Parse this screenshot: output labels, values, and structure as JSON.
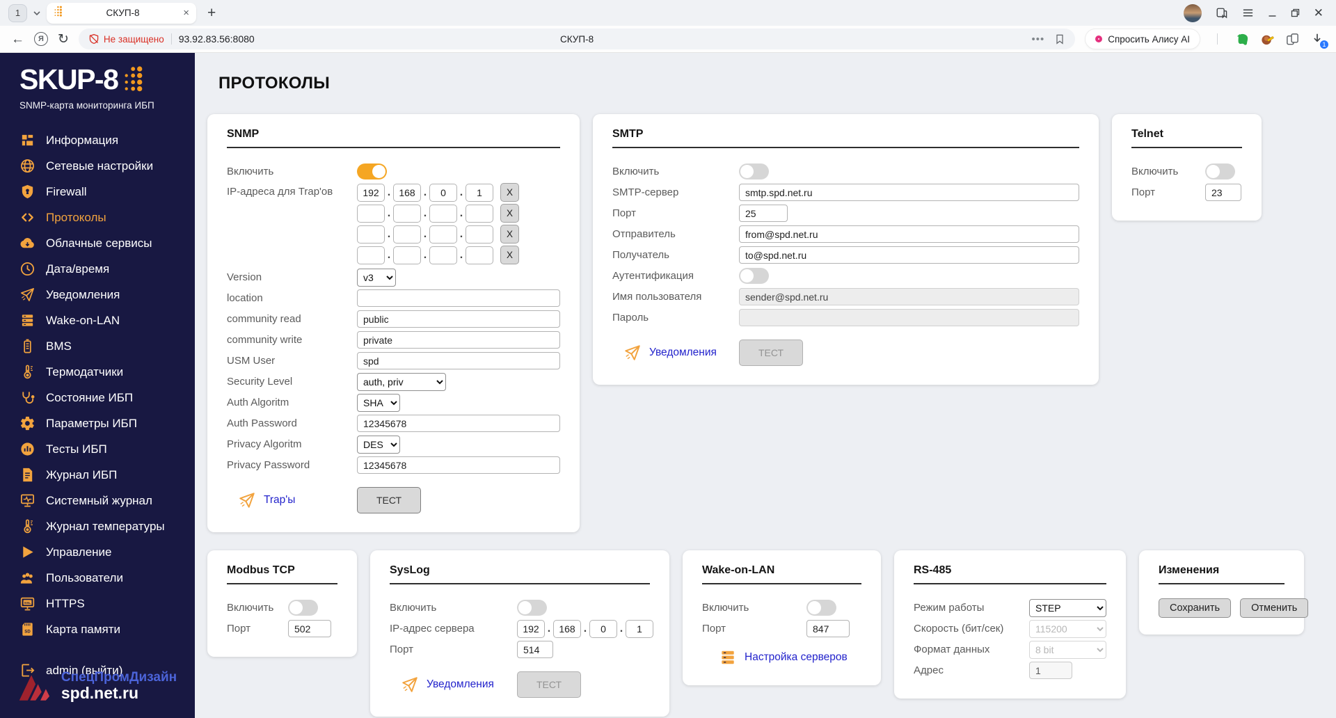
{
  "colors": {
    "sidebar_bg": "#181842",
    "accent_orange": "#f2a33e",
    "link_blue": "#2323cc",
    "warning_red": "#d93025",
    "toggle_on": "#f5a623"
  },
  "browser": {
    "tab_group_count": "1",
    "tab_title": "СКУП-8",
    "new_tab_label": "+",
    "security_text": "Не защищено",
    "url": "93.92.83.56:8080",
    "page_title": "СКУП-8",
    "alice_label": "Спросить Алису AI",
    "download_badge": "1"
  },
  "sidebar": {
    "logo_text": "SKUP-8",
    "subtitle": "SNMP-карта мониторинга ИБП",
    "items": [
      {
        "id": "info",
        "icon": "grid",
        "label": "Информация"
      },
      {
        "id": "network",
        "icon": "globe",
        "label": "Сетевые настройки"
      },
      {
        "id": "firewall",
        "icon": "shield",
        "label": "Firewall"
      },
      {
        "id": "protocols",
        "icon": "code",
        "label": "Протоколы",
        "active": true
      },
      {
        "id": "cloud",
        "icon": "cloud",
        "label": "Облачные сервисы"
      },
      {
        "id": "datetime",
        "icon": "clock",
        "label": "Дата/время"
      },
      {
        "id": "notifications",
        "icon": "send",
        "label": "Уведомления"
      },
      {
        "id": "wake-on-lan",
        "icon": "server",
        "label": "Wake-on-LAN"
      },
      {
        "id": "bms",
        "icon": "battery",
        "label": "BMS"
      },
      {
        "id": "thermosensors",
        "icon": "thermometer",
        "label": "Термодатчики"
      },
      {
        "id": "ups-status",
        "icon": "stethoscope",
        "label": "Состояние ИБП"
      },
      {
        "id": "ups-params",
        "icon": "gear",
        "label": "Параметры ИБП"
      },
      {
        "id": "ups-tests",
        "icon": "chart",
        "label": "Тесты ИБП"
      },
      {
        "id": "ups-log",
        "icon": "document",
        "label": "Журнал ИБП"
      },
      {
        "id": "system-log",
        "icon": "monitor",
        "label": "Системный журнал"
      },
      {
        "id": "temp-log",
        "icon": "thermometer",
        "label": "Журнал температуры"
      },
      {
        "id": "control",
        "icon": "play",
        "label": "Управление"
      },
      {
        "id": "users",
        "icon": "users",
        "label": "Пользователи"
      },
      {
        "id": "https",
        "icon": "ssl",
        "label": "HTTPS"
      },
      {
        "id": "memory-card",
        "icon": "sdcard",
        "label": "Карта памяти"
      },
      {
        "id": "logout",
        "icon": "logout",
        "label": "admin (выйти)",
        "gap_before": true
      }
    ],
    "footer": {
      "brand": "СпецПромДизайн",
      "site": "spd.net.ru"
    }
  },
  "page": {
    "title": "ПРОТОКОЛЫ"
  },
  "panels": {
    "snmp": {
      "title": "SNMP",
      "enable_label": "Включить",
      "enabled": "on",
      "trap_label": "IP-адреса для Trap'ов",
      "trap_ips": [
        [
          "192",
          "168",
          "0",
          "1"
        ],
        [
          "",
          "",
          "",
          ""
        ],
        [
          "",
          "",
          "",
          ""
        ],
        [
          "",
          "",
          "",
          ""
        ]
      ],
      "remove_label": "X",
      "version_label": "Version",
      "version_value": "v3",
      "location_label": "location",
      "location_value": "",
      "community_read_label": "community read",
      "community_read_value": "public",
      "community_write_label": "community write",
      "community_write_value": "private",
      "usm_user_label": "USM User",
      "usm_user_value": "spd",
      "security_level_label": "Security Level",
      "security_level_value": "auth, priv",
      "auth_algorithm_label": "Auth Algoritm",
      "auth_algorithm_value": "SHA",
      "auth_password_label": "Auth Password",
      "auth_password_value": "12345678",
      "privacy_algorithm_label": "Privacy Algoritm",
      "privacy_algorithm_value": "DES",
      "privacy_password_label": "Privacy Password",
      "privacy_password_value": "12345678",
      "traps_link": "Trap'ы",
      "test_button": "ТЕСТ"
    },
    "smtp": {
      "title": "SMTP",
      "enable_label": "Включить",
      "enabled": "off",
      "server_label": "SMTP-сервер",
      "server_value": "smtp.spd.net.ru",
      "port_label": "Порт",
      "port_value": "25",
      "sender_label": "Отправитель",
      "sender_value": "from@spd.net.ru",
      "recipient_label": "Получатель",
      "recipient_value": "to@spd.net.ru",
      "auth_label": "Аутентификация",
      "auth_enabled": "off",
      "username_label": "Имя пользователя",
      "username_value": "sender@spd.net.ru",
      "password_label": "Пароль",
      "password_value": "",
      "notifications_link": "Уведомления",
      "test_button": "ТЕСТ"
    },
    "telnet": {
      "title": "Telnet",
      "enable_label": "Включить",
      "enabled": "off",
      "port_label": "Порт",
      "port_value": "23"
    },
    "modbus": {
      "title": "Modbus TCP",
      "enable_label": "Включить",
      "enabled": "off",
      "port_label": "Порт",
      "port_value": "502"
    },
    "syslog": {
      "title": "SysLog",
      "enable_label": "Включить",
      "enabled": "off",
      "server_ip_label": "IP-адрес сервера",
      "server_ip": [
        "192",
        "168",
        "0",
        "1"
      ],
      "port_label": "Порт",
      "port_value": "514",
      "notifications_link": "Уведомления",
      "test_button": "ТЕСТ"
    },
    "wol": {
      "title": "Wake-on-LAN",
      "enable_label": "Включить",
      "enabled": "off",
      "port_label": "Порт",
      "port_value": "847",
      "servers_link": "Настройка серверов"
    },
    "rs485": {
      "title": "RS-485",
      "mode_label": "Режим работы",
      "mode_value": "STEP",
      "speed_label": "Скорость (бит/сек)",
      "speed_value": "115200",
      "format_label": "Формат данных",
      "format_value": "8 bit",
      "address_label": "Адрес",
      "address_value": "1"
    },
    "changes": {
      "title": "Изменения",
      "save_button": "Сохранить",
      "cancel_button": "Отменить"
    }
  }
}
